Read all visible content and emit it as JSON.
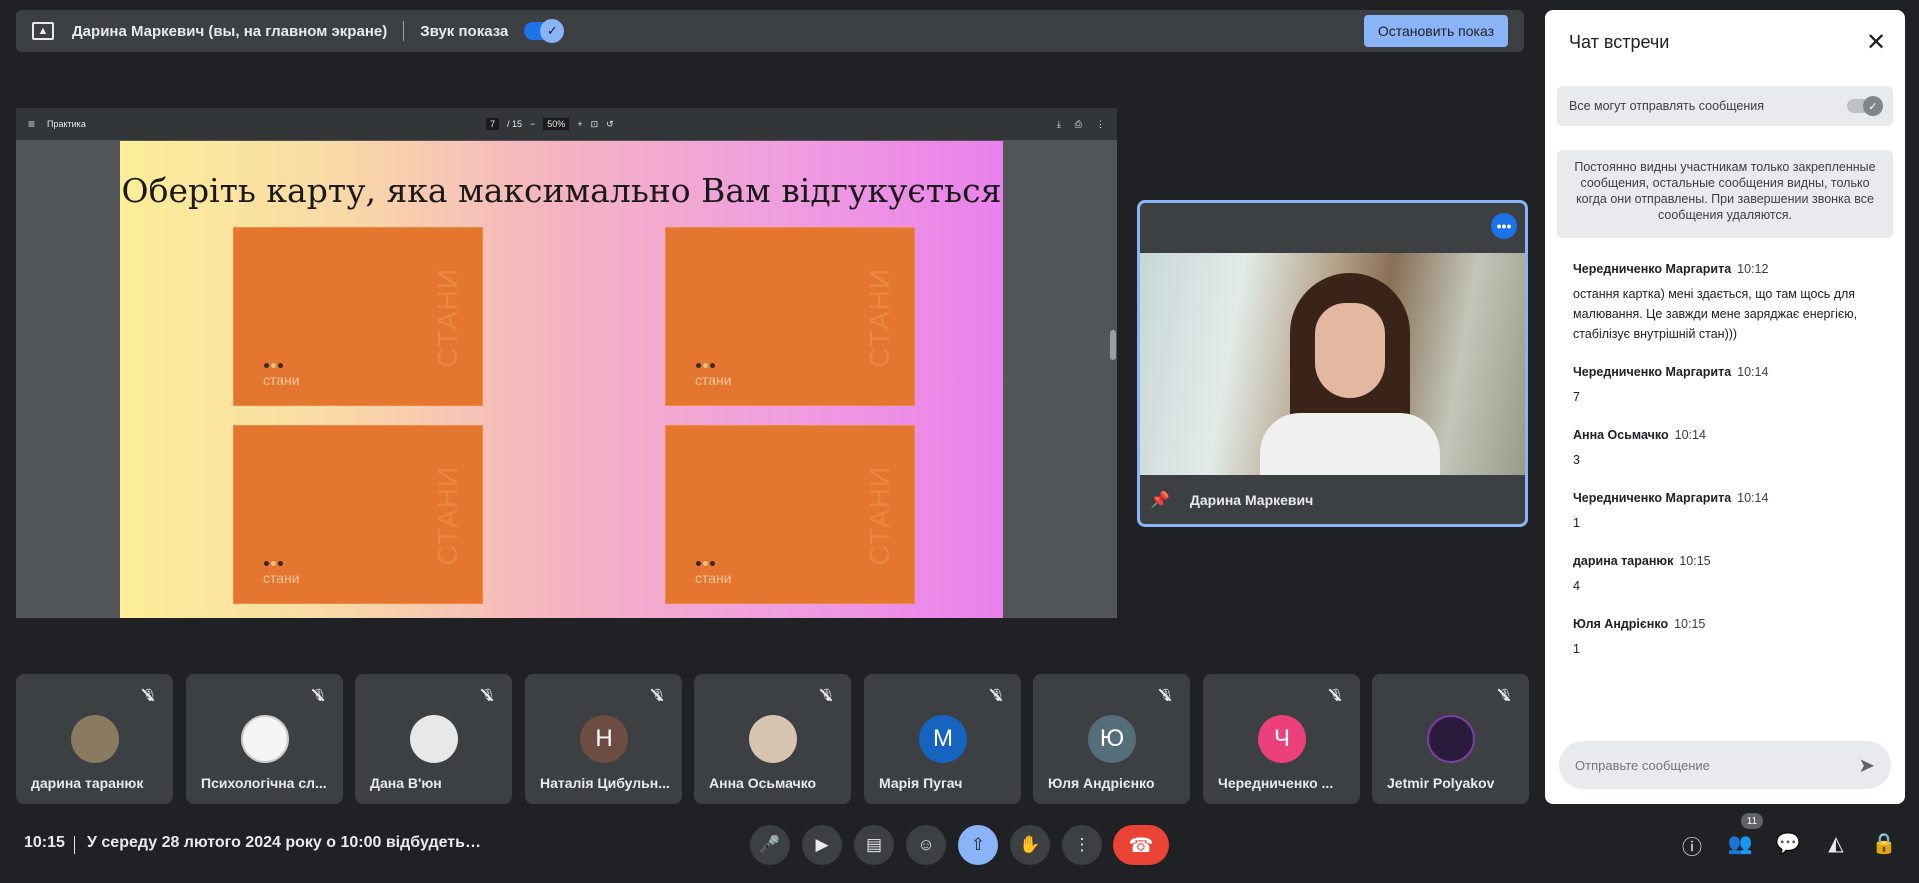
{
  "presenting_bar": {
    "presenter": "Дарина Маркевич (вы, на главном экране)",
    "sound_label": "Звук показа",
    "stop_button": "Остановить показ"
  },
  "pdf_viewer": {
    "title": "Практика",
    "page": "7",
    "page_total": "/ 15",
    "zoom": "50%"
  },
  "slide": {
    "title": "Оберіть карту, яка максимально Вам відгукується",
    "cards": [
      {
        "label": "стани",
        "vertical": "СТАНИ"
      },
      {
        "label": "стани",
        "vertical": "СТАНИ"
      },
      {
        "label": "стани",
        "vertical": "СТАНИ"
      },
      {
        "label": "стани",
        "vertical": "СТАНИ"
      }
    ]
  },
  "pinned_video": {
    "name": "Дарина Маркевич",
    "more_icon": "more-horiz-icon"
  },
  "participants": [
    {
      "name": "дарина таранюк",
      "initial": "",
      "color": "#8a7a60"
    },
    {
      "name": "Психологічна сл...",
      "initial": "",
      "color": "#f5f5f5"
    },
    {
      "name": "Дана В'юн",
      "initial": "",
      "color": "#e8e8e8"
    },
    {
      "name": "Наталія Цибульн...",
      "initial": "Н",
      "color": "#6d4c41"
    },
    {
      "name": "Анна Осьмачко",
      "initial": "",
      "color": "#d7c4b0"
    },
    {
      "name": "Марія Пугач",
      "initial": "М",
      "color": "#1565c0"
    },
    {
      "name": "Юля Андрієнко",
      "initial": "Ю",
      "color": "#546e7a"
    },
    {
      "name": "Чередниченко ...",
      "initial": "Ч",
      "color": "#ec407a"
    },
    {
      "name": "Jetmir Polyakov",
      "initial": "",
      "color": "#2a1b3d"
    }
  ],
  "bottom_bar": {
    "time": "10:15",
    "meeting_title": "У середу 28 лютого 2024 року о 10:00 відбудеться...",
    "people_count": "11"
  },
  "chat": {
    "title": "Чат встречи",
    "permission_label": "Все могут отправлять сообщения",
    "notice": "Постоянно видны участникам только закрепленные сообщения, остальные сообщения видны, только когда они отправлены. При завершении звонка все сообщения удаляются.",
    "messages": [
      {
        "sender": "Чередниченко Маргарита",
        "time": "10:12",
        "text": "остання картка) мені здається, що там щось для малювання. Це завжди мене заряджає енергією, стабілізує внутрішній стан)))"
      },
      {
        "sender": "Чередниченко Маргарита",
        "time": "10:14",
        "text": "7"
      },
      {
        "sender": "Анна Осьмачко",
        "time": "10:14",
        "text": "3"
      },
      {
        "sender": "Чередниченко Маргарита",
        "time": "10:14",
        "text": "1"
      },
      {
        "sender": "дарина таранюк",
        "time": "10:15",
        "text": "4"
      },
      {
        "sender": "Юля Андрієнко",
        "time": "10:15",
        "text": "1"
      }
    ],
    "input_placeholder": "Отправьте сообщение"
  }
}
